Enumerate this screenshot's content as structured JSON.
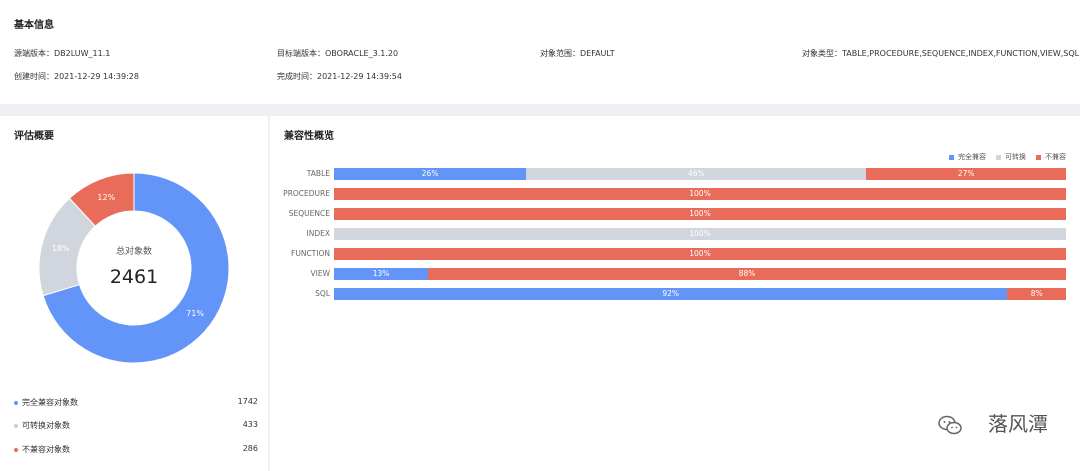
{
  "basic": {
    "title": "基本信息",
    "source_version": "源端版本：DB2LUW_11.1",
    "target_version": "目标端版本：OBORACLE_3.1.20",
    "object_scope": "对象范围：DEFAULT",
    "object_types": "对象类型：TABLE,PROCEDURE,SEQUENCE,INDEX,FUNCTION,VIEW,SQL",
    "created_time": "创建时间：2021-12-29 14:39:28",
    "finished_time": "完成时间：2021-12-29 14:39:54"
  },
  "summary": {
    "title": "评估概要",
    "total_label": "总对象数",
    "total_value": "2461",
    "slices": [
      {
        "label": "71%",
        "value": 71,
        "color": "#6395f9"
      },
      {
        "label": "18%",
        "value": 18,
        "color": "#d0d5de"
      },
      {
        "label": "12%",
        "value": 12,
        "color": "#e96b5a"
      }
    ],
    "legend": [
      {
        "label": "完全兼容对象数",
        "count": "1742",
        "color": "#6395f9"
      },
      {
        "label": "可转换对象数",
        "count": "433",
        "color": "#c7ccd6"
      },
      {
        "label": "不兼容对象数",
        "count": "286",
        "color": "#e96b5a"
      }
    ]
  },
  "compat": {
    "title": "兼容性概览",
    "legend": [
      {
        "label": "完全兼容",
        "color": "#6395f9"
      },
      {
        "label": "可转换",
        "color": "#d0d5de"
      },
      {
        "label": "不兼容",
        "color": "#e96b5a"
      }
    ]
  },
  "chart_data": {
    "type": "bar",
    "orientation": "horizontal",
    "stacked": true,
    "categories": [
      "TABLE",
      "PROCEDURE",
      "SEQUENCE",
      "INDEX",
      "FUNCTION",
      "VIEW",
      "SQL"
    ],
    "series": [
      {
        "name": "完全兼容",
        "color": "#6395f9",
        "values": [
          26,
          0,
          0,
          0,
          0,
          13,
          92
        ],
        "labels": [
          "26%",
          "",
          "",
          "",
          "",
          "13%",
          "92%"
        ]
      },
      {
        "name": "可转换",
        "color": "#d0d5de",
        "values": [
          46,
          0,
          0,
          100,
          0,
          0,
          0
        ],
        "labels": [
          "46%",
          "",
          "",
          "100%",
          "",
          "",
          ""
        ]
      },
      {
        "name": "不兼容",
        "color": "#e96b5a",
        "values": [
          27,
          100,
          100,
          0,
          100,
          88,
          8
        ],
        "labels": [
          "27%",
          "100%",
          "100%",
          "",
          "100%",
          "88%",
          "8%"
        ]
      }
    ],
    "legend_position": "top-right",
    "xlim": [
      0,
      100
    ]
  },
  "watermark": {
    "text": "落风潭"
  }
}
